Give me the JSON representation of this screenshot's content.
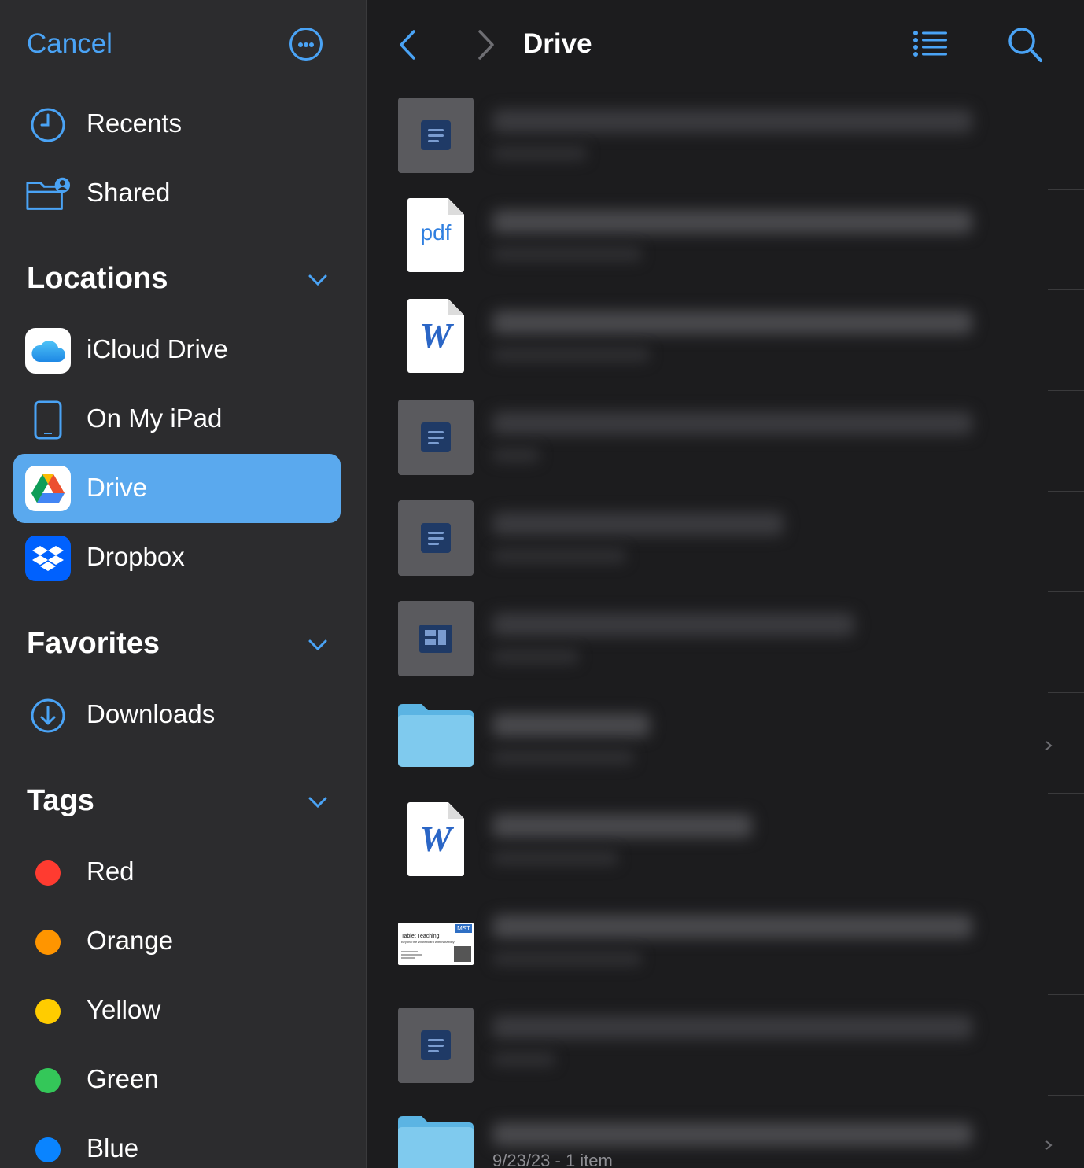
{
  "sidebar": {
    "cancel_label": "Cancel",
    "top_items": [
      {
        "label": "Recents",
        "icon": "clock-icon"
      },
      {
        "label": "Shared",
        "icon": "shared-folder-icon"
      }
    ],
    "locations": {
      "title": "Locations",
      "items": [
        {
          "label": "iCloud Drive",
          "icon": "icloud-icon"
        },
        {
          "label": "On My iPad",
          "icon": "ipad-icon"
        },
        {
          "label": "Drive",
          "icon": "google-drive-icon",
          "selected": true
        },
        {
          "label": "Dropbox",
          "icon": "dropbox-icon"
        }
      ]
    },
    "favorites": {
      "title": "Favorites",
      "items": [
        {
          "label": "Downloads",
          "icon": "download-icon"
        }
      ]
    },
    "tags": {
      "title": "Tags",
      "items": [
        {
          "label": "Red",
          "color": "#ff3b30"
        },
        {
          "label": "Orange",
          "color": "#ff9500"
        },
        {
          "label": "Yellow",
          "color": "#ffcc00"
        },
        {
          "label": "Green",
          "color": "#34c759"
        },
        {
          "label": "Blue",
          "color": "#0a84ff"
        }
      ]
    }
  },
  "header": {
    "title": "Drive",
    "back_icon": "chevron-left-icon",
    "forward_icon": "chevron-right-icon",
    "list_icon": "list-view-icon",
    "search_icon": "search-icon"
  },
  "files": {
    "items": [
      {
        "type": "gdoc",
        "blurred": true
      },
      {
        "type": "pdf",
        "badge": "pdf",
        "blurred": true
      },
      {
        "type": "word",
        "badge": "W",
        "blurred": true
      },
      {
        "type": "gdoc",
        "blurred": true
      },
      {
        "type": "gdoc",
        "blurred": true
      },
      {
        "type": "gslides",
        "blurred": true
      },
      {
        "type": "folder",
        "blurred": true
      },
      {
        "type": "word",
        "badge": "W",
        "blurred": true
      },
      {
        "type": "slide-thumb",
        "thumb_title": "Tablet Teaching",
        "thumb_subtitle": "Beyond the Whiteboard with Notability",
        "thumb_badge": "MST",
        "blurred": true
      },
      {
        "type": "gdoc",
        "blurred": true
      },
      {
        "type": "folder",
        "meta": "9/23/23 - 1 item",
        "blurred": true
      }
    ]
  },
  "colors": {
    "accent": "#4aa3f5",
    "selection": "#5aa9ee",
    "sidebar_bg": "#2c2c2e",
    "main_bg": "#1c1c1e"
  }
}
